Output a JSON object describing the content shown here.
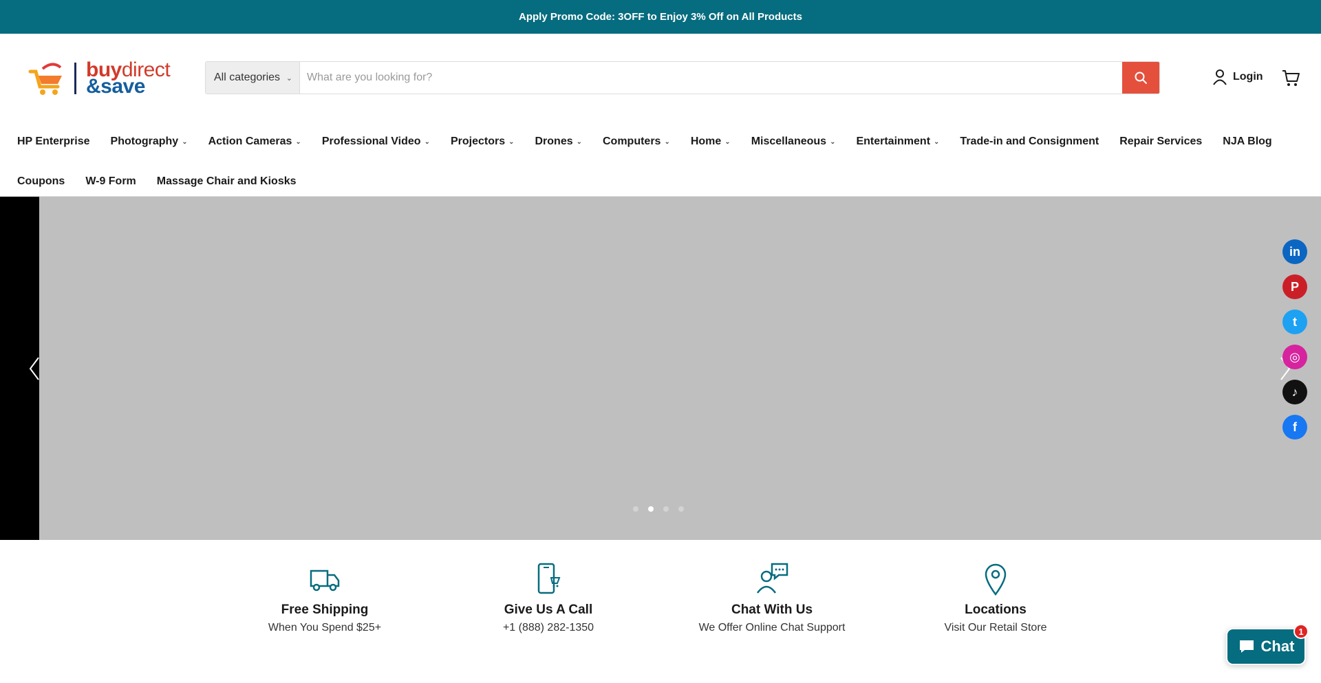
{
  "promo": {
    "text": "Apply Promo Code: 3OFF to Enjoy 3% Off on All Products"
  },
  "logo": {
    "line1_bold": "buy",
    "line1_thin": "direct",
    "line2": "&save"
  },
  "search": {
    "category": "All categories",
    "placeholder": "What are you looking for?"
  },
  "account": {
    "login_label": "Login"
  },
  "nav": {
    "row1": [
      {
        "label": "HP Enterprise",
        "dropdown": false
      },
      {
        "label": "Photography",
        "dropdown": true
      },
      {
        "label": "Action Cameras",
        "dropdown": true
      },
      {
        "label": "Professional Video",
        "dropdown": true
      },
      {
        "label": "Projectors",
        "dropdown": true
      },
      {
        "label": "Drones",
        "dropdown": true
      },
      {
        "label": "Computers",
        "dropdown": true
      },
      {
        "label": "Home",
        "dropdown": true
      },
      {
        "label": "Miscellaneous",
        "dropdown": true
      },
      {
        "label": "Entertainment",
        "dropdown": true
      },
      {
        "label": "Trade-in and Consignment",
        "dropdown": false
      },
      {
        "label": "Repair Services",
        "dropdown": false
      },
      {
        "label": "NJA Blog",
        "dropdown": false
      }
    ],
    "row2": [
      {
        "label": "Coupons",
        "dropdown": false
      },
      {
        "label": "W-9 Form",
        "dropdown": false
      },
      {
        "label": "Massage Chair and Kiosks",
        "dropdown": false
      }
    ]
  },
  "slideshow": {
    "slide_count": 4,
    "active_index": 1
  },
  "social": [
    {
      "name": "linkedin-icon",
      "color": "#0a66c2",
      "glyph": "in"
    },
    {
      "name": "pinterest-icon",
      "color": "#cb1f27",
      "glyph": "P"
    },
    {
      "name": "twitter-icon",
      "color": "#1da1f2",
      "glyph": "t"
    },
    {
      "name": "instagram-icon",
      "color": "#d6249f",
      "glyph": "◎"
    },
    {
      "name": "tiktok-icon",
      "color": "#111111",
      "glyph": "♪"
    },
    {
      "name": "facebook-icon",
      "color": "#1877f2",
      "glyph": "f"
    }
  ],
  "features": [
    {
      "title": "Free Shipping",
      "subtitle": "When You Spend $25+",
      "icon": "truck-icon"
    },
    {
      "title": "Give Us A Call",
      "subtitle": "+1 (888) 282-1350",
      "icon": "phone-icon"
    },
    {
      "title": "Chat With Us",
      "subtitle": "We Offer Online Chat Support",
      "icon": "chat-support-icon"
    },
    {
      "title": "Locations",
      "subtitle": "Visit Our Retail Store",
      "icon": "location-pin-icon"
    }
  ],
  "chat_widget": {
    "label": "Chat",
    "badge": "1"
  },
  "colors": {
    "accent": "#066c7f",
    "search_button": "#e4503c",
    "hero_bg": "#bfbfbf"
  }
}
